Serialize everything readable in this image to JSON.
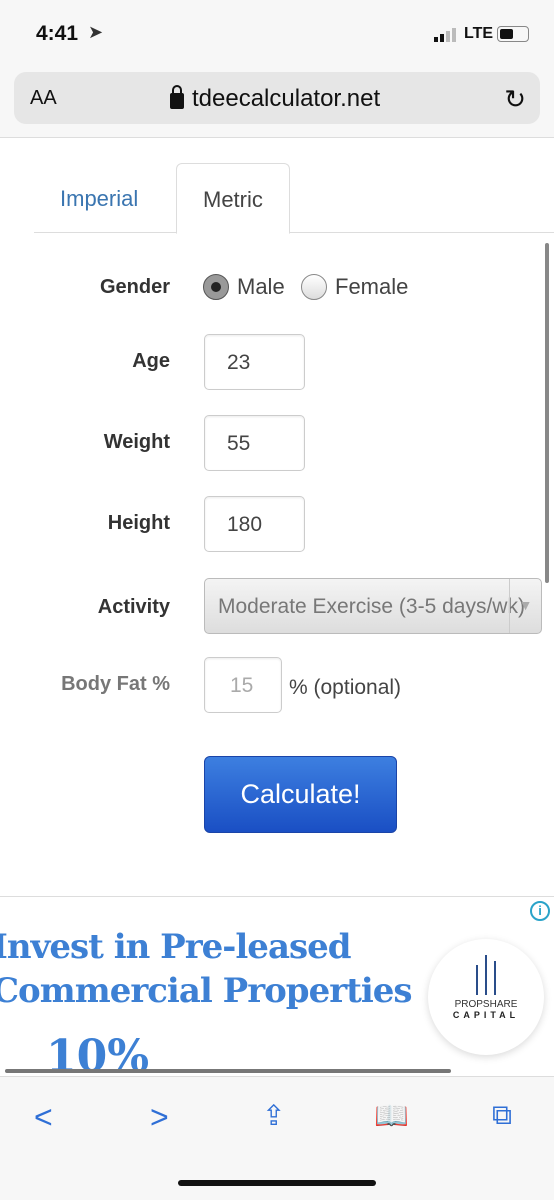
{
  "status": {
    "time": "4:41",
    "network": "LTE",
    "battery_level": 0.5
  },
  "browser": {
    "text_size": "AA",
    "host": "tdeecalculator.net"
  },
  "tabs": [
    {
      "label": "Imperial",
      "active": false
    },
    {
      "label": "Metric",
      "active": true
    }
  ],
  "form": {
    "gender": {
      "label": "Gender",
      "options": [
        "Male",
        "Female"
      ],
      "selected": "Male"
    },
    "age": {
      "label": "Age",
      "value": "23"
    },
    "weight": {
      "label": "Weight",
      "value": "55"
    },
    "height": {
      "label": "Height",
      "value": "180"
    },
    "activity": {
      "label": "Activity",
      "value": "Moderate Exercise (3-5 days/wk)"
    },
    "bodyfat": {
      "label": "Body Fat %",
      "placeholder": "15",
      "suffix": "% (optional)"
    },
    "submit": "Calculate!"
  },
  "ad": {
    "line1": "Invest in Pre-leased",
    "line2": "Commercial Properties",
    "figure": "10%",
    "brand1": "PROPSHARE",
    "brand2": "CAPITAL"
  },
  "colors": {
    "link": "#3a75b0",
    "button": "#2a62d4",
    "ad_text": "#3d80d4"
  }
}
